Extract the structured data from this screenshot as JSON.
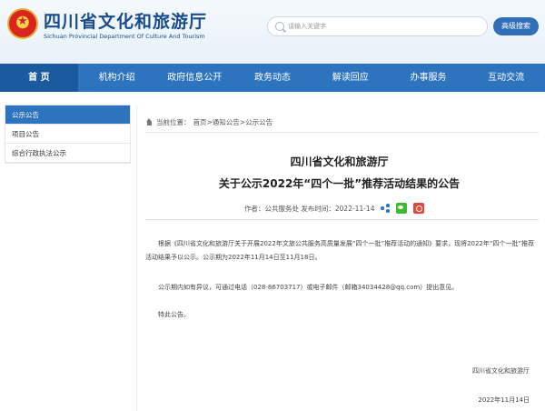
{
  "header": {
    "title": "四川省文化和旅游厅",
    "subtitle": "Sichuan Provincial Department Of Culture And Tourism",
    "search_placeholder": "请输入关键字",
    "advanced_search": "高级搜索"
  },
  "nav": {
    "items": [
      "首 页",
      "机构介绍",
      "政府信息公开",
      "政务动态",
      "解读回应",
      "办事服务",
      "互动交流"
    ]
  },
  "sidebar": {
    "items": [
      "公示公告",
      "项目公告",
      "综合行政执法公示"
    ]
  },
  "breadcrumb": {
    "label": "当前位置：",
    "path": "首页>通知公告>公示公告"
  },
  "article": {
    "org": "四川省文化和旅游厅",
    "title": "关于公示2022年“四个一批”推荐活动结果的公告",
    "meta": "作者：公共服务处   发布时间：2022-11-14",
    "paragraphs": [
      "根据《四川省文化和旅游厅关于开展2022年文旅公共服务高质量发展“四个一批”推荐活动的通知》要求，现将2022年“四个一批”推荐活动结果予以公示。公示期为2022年11月14日至11月18日。",
      "公示期内如有异议，可通过电话（028-86703717）或电子邮件（邮箱34034428@qq.com）提出意见。",
      "特此公告。"
    ],
    "signature": "四川省文化和旅游厅",
    "date": "2022年11月14日"
  },
  "colors": {
    "nav_bg": "#2d73bd",
    "nav_active": "#1c5aa0",
    "title_blue": "#1a4c8c"
  }
}
